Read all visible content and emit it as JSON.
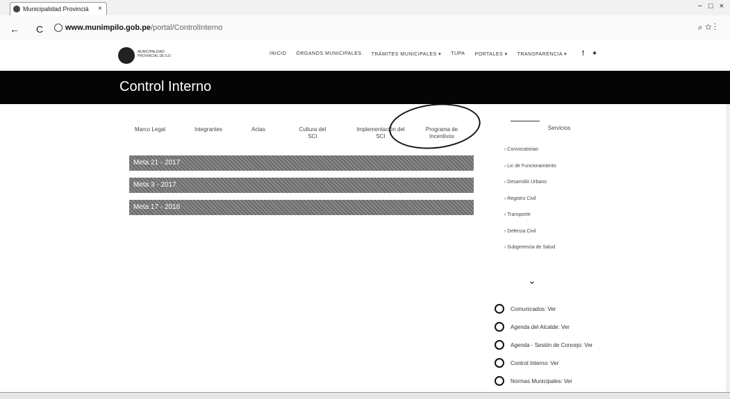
{
  "browser": {
    "tab_title": "Municipalidad Provinciá",
    "tab_close": "×",
    "win_controls": "− □ ×",
    "back": "←",
    "reload": "C",
    "url_domain": "www.munimpilo.gob.pe",
    "url_path": "/portal/ControlInterno",
    "star": "☆",
    "zoom": "⌕",
    "menu": "⋮"
  },
  "site": {
    "logo_text": "MUNICIPALIDAD PROVINCIAL DE ILO",
    "nav": [
      "INICIO",
      "ÓRGANOS MUNICIPALES",
      "TRÁMITES MUNICIPALES ▾",
      "TUPA",
      "PORTALES ▾",
      "TRANSPARENCIA ▾"
    ],
    "social_facebook": "f",
    "social_twitter": "✦"
  },
  "hero": {
    "title": "Control Interno"
  },
  "tabs": [
    "Marco Legal",
    "Integrantes",
    "Actas",
    "Cultura del SCI",
    "Implementación del SCI",
    "Programa de Incentivos",
    "Servicios"
  ],
  "metas": [
    "Meta 21 - 2017",
    "Meta 3 - 2017",
    "Meta 17 - 2016"
  ],
  "servicios": [
    "› Convocatorias",
    "› Lic de Funcionamiento",
    "› Desarrollo Urbano",
    "› Registro Civil",
    "› Transporte",
    "› Defensa Civil",
    "› Subgerencia de Salud"
  ],
  "expand": "⌄",
  "quick_links": [
    "Comunicados: Ver",
    "Agenda del Alcalde: Ver",
    "Agenda - Sesión de Concejo: Ver",
    "Control Interno: Ver",
    "Normas Municipales: Ver"
  ],
  "colors": {
    "hero_bg": "#050505",
    "meta_bg": "#777777"
  }
}
